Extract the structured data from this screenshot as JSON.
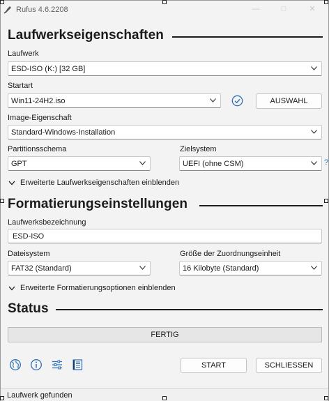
{
  "window": {
    "title": "Rufus 4.6.2208"
  },
  "sections": {
    "drive": "Laufwerkseigenschaften",
    "format": "Formatierungseinstellungen",
    "status": "Status"
  },
  "drive": {
    "device_label": "Laufwerk",
    "device_value": "ESD-ISO (K:) [32 GB]",
    "boot_label": "Startart",
    "boot_value": "Win11-24H2.iso",
    "select_button": "AUSWAHL",
    "image_option_label": "Image-Eigenschaft",
    "image_option_value": "Standard-Windows-Installation",
    "partition_label": "Partitionsschema",
    "partition_value": "GPT",
    "target_label": "Zielsystem",
    "target_value": "UEFI (ohne CSM)",
    "help_mark": "?",
    "advanced_toggle": "Erweiterte Laufwerkseigenschaften einblenden"
  },
  "format": {
    "volume_label": "Laufwerksbezeichnung",
    "volume_value": "ESD-ISO",
    "fs_label": "Dateisystem",
    "fs_value": "FAT32 (Standard)",
    "cluster_label": "Größe der Zuordnungseinheit",
    "cluster_value": "16 Kilobyte (Standard)",
    "advanced_toggle": "Erweiterte Formatierungsoptionen einblenden"
  },
  "status": {
    "progress_text": "FERTIG",
    "progress_fraction": 0
  },
  "buttons": {
    "start": "START",
    "close": "SCHLIESSEN"
  },
  "statusbar": {
    "text": "Laufwerk gefunden"
  },
  "colors": {
    "accent": "#2f6fb5",
    "window_bg": "#f3f3f3",
    "text": "#1b1b1b"
  },
  "icons": [
    "globe-icon",
    "info-icon",
    "settings-sliders-icon",
    "log-icon",
    "check-circle-icon",
    "chevron-down-icon"
  ]
}
